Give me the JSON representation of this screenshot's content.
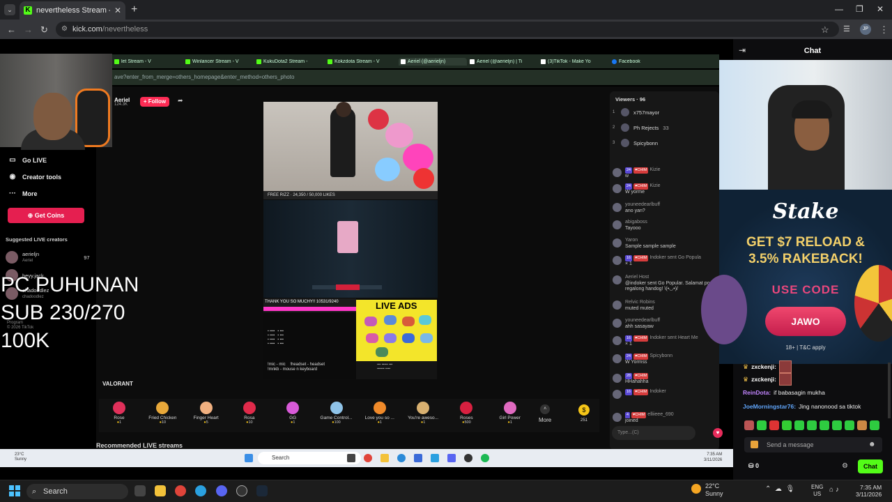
{
  "browser": {
    "tab_title": "nevertheless Stream - Watch Li",
    "tab_close": "✕",
    "new_tab": "+",
    "url_domain": "kick.com",
    "url_path": "/nevertheless",
    "win_min": "—",
    "win_max": "❐",
    "win_close": "✕",
    "tab_menu": "⌄",
    "back": "←",
    "forward": "→",
    "reload": "↻",
    "star": "☆",
    "profile": "JP",
    "menu": "⋮"
  },
  "inner_browser": {
    "tabs": [
      {
        "label": "let Stream - V"
      },
      {
        "label": "Winlancer Stream - V"
      },
      {
        "label": "KukuDota2 Stream -"
      },
      {
        "label": "Kokzdota Stream - V"
      },
      {
        "label": "Aeriel (@aerieljn)"
      },
      {
        "label": "Aeriel (@aerieljn) | Ti"
      },
      {
        "label": "(3)TikTok - Make Yo"
      },
      {
        "label": "Facebook"
      }
    ],
    "url": "ave?enter_from_merge=others_homepage&enter_method=others_photo"
  },
  "tiktok": {
    "profile_name": "Aeriel",
    "profile_followers": "124.3K",
    "follow_label": "+ Follow",
    "share": "➦",
    "vid1_caption": "FREE RIZZ · 24,350 / 50,000 LIKES",
    "vid3_title": "THANK YOU SO MUCHY!!  10531/9240",
    "vid3_lines": "!mic - mic    !headset - headset\n!mnkb - mouse n keyboard",
    "live_ads": "LIVE ADS",
    "valorant": "VALORANT",
    "recommended": "Recommended LIVE streams",
    "gifts": [
      {
        "name": "Rose",
        "cost": "1",
        "color": "#e0305a"
      },
      {
        "name": "Fried Chicken",
        "cost": "10",
        "color": "#e8a83a"
      },
      {
        "name": "Finger Heart",
        "cost": "5",
        "color": "#f0b080"
      },
      {
        "name": "Rosa",
        "cost": "10",
        "color": "#e02a4a"
      },
      {
        "name": "GG",
        "cost": "1",
        "color": "#d85ad8"
      },
      {
        "name": "Game Control...",
        "cost": "100",
        "color": "#8fc3e8"
      },
      {
        "name": "Love you so ...",
        "cost": "1",
        "color": "#f08a2a"
      },
      {
        "name": "You're aweso...",
        "cost": "1",
        "color": "#d8b070"
      },
      {
        "name": "Roses",
        "cost": "500",
        "color": "#d82040"
      },
      {
        "name": "Girl Power",
        "cost": "1",
        "color": "#e06ac0"
      }
    ],
    "more": "More",
    "coins_count": "251",
    "viewers_label": "Viewers · 96",
    "viewers": [
      {
        "rank": "1",
        "name": "x757mayor",
        "extra": ""
      },
      {
        "rank": "2",
        "name": "Ph Rejects",
        "extra": "33"
      },
      {
        "rank": "3",
        "name": "Spicybonn",
        "extra": ""
      }
    ],
    "comments": [
      {
        "badge": "24",
        "name": "Kizie",
        "text": "w"
      },
      {
        "badge": "24",
        "name": "Kizie",
        "text": "W yorme"
      },
      {
        "badge": "",
        "name": "youneedearlbuff",
        "text": "ano yan?"
      },
      {
        "badge": "",
        "name": "abigaboss",
        "text": "Tayooo"
      },
      {
        "badge": "",
        "name": "Yaron",
        "text": "Sample sample sample"
      },
      {
        "badge": "16",
        "name": "Indoker sent Go Popula",
        "text": "× 1"
      },
      {
        "badge": "",
        "name": "Aeriel  Host",
        "text": "@indoker sent Go Popular. Salamat po sa regalong handog! \\(•◡•)/"
      },
      {
        "badge": "",
        "name": "Relvic Robins",
        "text": "muted muted"
      },
      {
        "badge": "",
        "name": "youneedearlbuff",
        "text": "ahh sasayaw"
      },
      {
        "badge": "16",
        "name": "Indoker sent Heart Me",
        "text": "× 1"
      },
      {
        "badge": "24",
        "name": "Spicybonn",
        "text": "W Yormss"
      },
      {
        "badge": "28",
        "name": "",
        "text": "HHahahha"
      },
      {
        "badge": "16",
        "name": "Indoker",
        "text": ""
      },
      {
        "badge": "4",
        "name": "elliieee_690",
        "text": "joined"
      }
    ],
    "input_placeholder": "Type...(C)",
    "heart": "♥"
  },
  "sidebar": {
    "items": [
      {
        "icon": "▭",
        "label": "Go LIVE"
      },
      {
        "icon": "◉",
        "label": "Creator tools"
      },
      {
        "icon": "···",
        "label": "More"
      }
    ],
    "get_coins": "⊕ Get Coins",
    "suggested_label": "Suggested LIVE creators",
    "suggested": [
      {
        "name": "aerieljn",
        "sub": "Aeriel",
        "count": "97"
      },
      {
        "name": "heyy.jack",
        "sub": "",
        "count": ""
      },
      {
        "name": "chadoodlez",
        "sub": "chadoodlez",
        "count": ""
      }
    ],
    "tiny": "Program\n© 2026 TikTok"
  },
  "overlay": {
    "line1": "PC PUHUNAN",
    "line2": "SUB 230/270",
    "line3": "100K"
  },
  "inner_taskbar": {
    "weather": "23°C\nSunny",
    "search": "Search",
    "time": "7:35 AM",
    "date": "3/11/2026"
  },
  "kick_chat": {
    "title": "Chat",
    "stake_logo": "Stake",
    "promo_line1": "GET $7 RELOAD &",
    "promo_line2": "3.5% RAKEBACK!",
    "use_code": "USE CODE",
    "code": "JAWO",
    "terms": "18+ | T&C apply",
    "messages": [
      {
        "user": "zxckenji:",
        "text": "",
        "color": "#ffffff",
        "kind": "box"
      },
      {
        "user": "zxckenji:",
        "text": "",
        "color": "#ffffff",
        "kind": "box"
      },
      {
        "user": "ReinDota:",
        "text": "if babasagin mukha",
        "color": "#c084fc",
        "kind": "text"
      },
      {
        "user": "JoeMorningstar76:",
        "text": "Jing nanonood sa tiktok",
        "color": "#60a5fa",
        "kind": "text"
      }
    ],
    "input_placeholder": "Send a message",
    "points": "0",
    "chat_button": "Chat",
    "emote_colors": [
      "#b55",
      "#2ecc40",
      "#d33",
      "#3c3",
      "#2ecc40",
      "#2ecc40",
      "#2ecc40",
      "#2ecc40",
      "#2ecc40",
      "#c84",
      "#2ecc40"
    ]
  },
  "taskbar": {
    "search": "Search",
    "weather_temp": "22°C",
    "weather_cond": "Sunny",
    "lang1": "ENG",
    "lang2": "US",
    "time": "7:35 AM",
    "date": "3/11/2026"
  }
}
